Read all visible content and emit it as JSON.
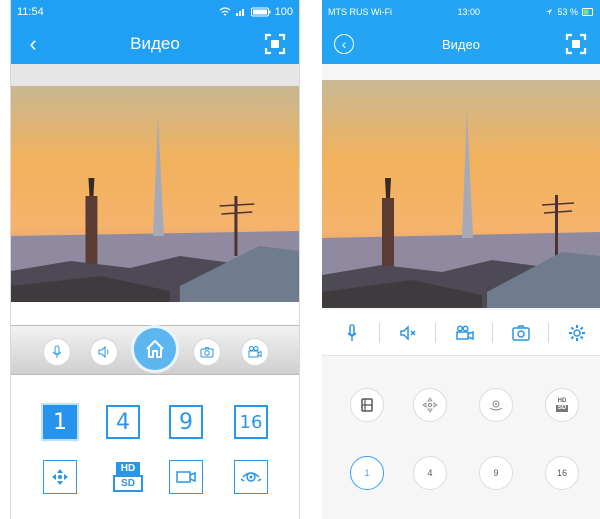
{
  "left_phone": {
    "status": {
      "time": "11:54",
      "battery": "100"
    },
    "header": {
      "title": "Видео",
      "back_icon": "chevron-left-icon",
      "fullscreen_icon": "fullscreen-icon"
    },
    "controls": [
      "microphone-icon",
      "speaker-icon",
      "home-icon",
      "camera-icon",
      "video-record-icon"
    ],
    "grid": {
      "layouts": [
        "1",
        "4",
        "9",
        "16"
      ],
      "active_layout": "1",
      "quality_hd": "HD",
      "quality_sd": "SD",
      "row2_icons": [
        "ptz-arrows-icon",
        "hd-sd-icon",
        "camcorder-icon",
        "panorama-icon"
      ]
    },
    "colors": {
      "accent": "#1fa0f5",
      "grid": "#2b95e6"
    }
  },
  "right_phone": {
    "status": {
      "carrier": "MTS RUS Wi-Fi",
      "time": "13:00",
      "battery": "53 %"
    },
    "header": {
      "title": "Видео",
      "back_icon": "circle-back-icon",
      "fullscreen_icon": "fullscreen-icon"
    },
    "toolbar": [
      "microphone-icon",
      "mute-icon",
      "video-record-icon",
      "camera-icon",
      "gear-icon"
    ],
    "circle_row1": {
      "icons": [
        "film-icon",
        "ptz-arrows-icon",
        "panorama-icon",
        "hd-sd-icon"
      ],
      "hd": "HD",
      "sd": "SD"
    },
    "circle_row2": {
      "layouts": [
        "1",
        "4",
        "9",
        "16"
      ],
      "active_layout": "1"
    },
    "colors": {
      "accent": "#23a5f3"
    }
  }
}
